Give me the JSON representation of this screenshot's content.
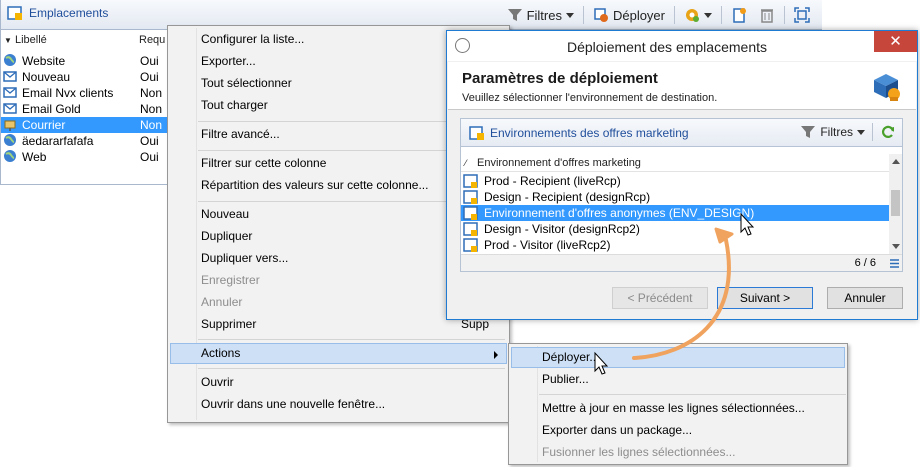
{
  "main_window": {
    "title": "Emplacements",
    "toolbar": {
      "filters_label": "Filtres",
      "deploy_label": "Déployer"
    },
    "columns": [
      "Libellé",
      "Requ"
    ],
    "rows": [
      {
        "label": "Website",
        "value": "Oui"
      },
      {
        "label": "Nouveau",
        "value": "Oui"
      },
      {
        "label": "Email Nvx clients",
        "value": "Non"
      },
      {
        "label": "Email Gold",
        "value": "Non"
      },
      {
        "label": "Courrier",
        "value": "Non"
      },
      {
        "label": "äedararfafafa",
        "value": "Oui"
      },
      {
        "label": "Web",
        "value": "Oui"
      }
    ]
  },
  "context_menu": {
    "configure": "Configurer la liste...",
    "export": "Exporter...",
    "select_all": "Tout sélectionner",
    "load_all": "Tout charger",
    "advanced_filter": "Filtre avancé...",
    "filter_column": "Filtrer sur cette colonne",
    "value_distribution": "Répartition des valeurs sur cette colonne...",
    "new": "Nouveau",
    "duplicate": "Dupliquer",
    "duplicate_to": "Dupliquer vers...",
    "save": "Enregistrer",
    "cancel": "Annuler",
    "delete": "Supprimer",
    "delete_shortcut": "Supp",
    "actions": "Actions",
    "open": "Ouvrir",
    "open_new_window": "Ouvrir dans une nouvelle fenêtre..."
  },
  "submenu": {
    "deploy": "Déployer...",
    "publish": "Publier...",
    "mass_update": "Mettre à jour en masse les lignes sélectionnées...",
    "export_package": "Exporter dans un package...",
    "merge": "Fusionner les lignes sélectionnées..."
  },
  "dialog": {
    "title": "Déploiement des emplacements",
    "heading": "Paramètres de déploiement",
    "subheading": "Veuillez sélectionner l'environnement de destination.",
    "panel_title": "Environnements des offres marketing",
    "filters_label": "Filtres",
    "column_header": "Environnement d'offres marketing",
    "rows": [
      "Prod - Recipient (liveRcp)",
      "Design - Recipient (designRcp)",
      "Environnement d'offres anonymes (ENV_DESIGN)",
      "Design - Visitor (designRcp2)",
      "Prod - Visitor (liveRcp2)"
    ],
    "count": "6 / 6",
    "buttons": {
      "previous": "< Précédent",
      "next": "Suivant >",
      "cancel": "Annuler"
    }
  },
  "colors": {
    "selection": "#3399ff",
    "link_blue": "#1f4e9b",
    "arrow_orange": "#f0a35e",
    "close_red": "#c7463c",
    "menu_highlight": "#cde0f6"
  }
}
